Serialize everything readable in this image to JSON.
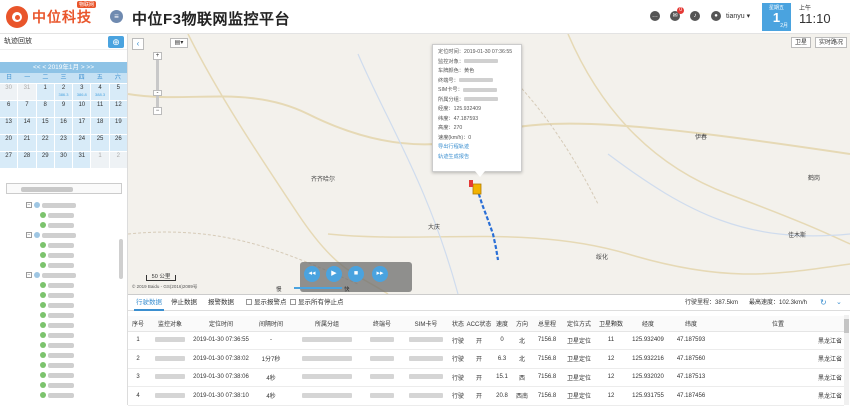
{
  "header": {
    "logo_text": "中位科技",
    "logo_badge": "物联网",
    "title": "中位F3物联网监控平台",
    "notification_count": "0",
    "username": "tianyu",
    "date_week": "星期五",
    "date_day": "1",
    "date_month": "2月",
    "time_ampm": "上午",
    "time": "11:10"
  },
  "left_panel": {
    "title": "轨迹回放",
    "add_icon": "plus-icon",
    "calendar": {
      "nav_label": "<<  < 2019年1月 >  >>",
      "weekdays": [
        "日",
        "一",
        "二",
        "三",
        "四",
        "五",
        "六"
      ],
      "cells": [
        {
          "d": "30",
          "s": "",
          "off": true
        },
        {
          "d": "31",
          "s": "",
          "off": true
        },
        {
          "d": "1",
          "s": "",
          "off": false
        },
        {
          "d": "2",
          "s": "386.3",
          "off": false
        },
        {
          "d": "3",
          "s": "386.8",
          "off": false
        },
        {
          "d": "4",
          "s": "388.3",
          "off": false
        },
        {
          "d": "5",
          "s": "",
          "off": false
        },
        {
          "d": "6",
          "s": "",
          "off": false
        },
        {
          "d": "7",
          "s": "",
          "off": false
        },
        {
          "d": "8",
          "s": "",
          "off": false
        },
        {
          "d": "9",
          "s": "",
          "off": false
        },
        {
          "d": "10",
          "s": "",
          "off": false
        },
        {
          "d": "11",
          "s": "",
          "off": false
        },
        {
          "d": "12",
          "s": "",
          "off": false
        },
        {
          "d": "13",
          "s": "",
          "off": false
        },
        {
          "d": "14",
          "s": "",
          "off": false
        },
        {
          "d": "15",
          "s": "",
          "off": false
        },
        {
          "d": "16",
          "s": "",
          "off": false
        },
        {
          "d": "17",
          "s": "",
          "off": false
        },
        {
          "d": "18",
          "s": "",
          "off": false
        },
        {
          "d": "19",
          "s": "",
          "off": false
        },
        {
          "d": "20",
          "s": "",
          "off": false
        },
        {
          "d": "21",
          "s": "",
          "off": false
        },
        {
          "d": "22",
          "s": "",
          "off": false
        },
        {
          "d": "23",
          "s": "",
          "off": false
        },
        {
          "d": "24",
          "s": "",
          "off": false
        },
        {
          "d": "25",
          "s": "",
          "off": false
        },
        {
          "d": "26",
          "s": "",
          "off": false
        },
        {
          "d": "27",
          "s": "",
          "off": false
        },
        {
          "d": "28",
          "s": "",
          "off": false
        },
        {
          "d": "29",
          "s": "",
          "off": false
        },
        {
          "d": "30",
          "s": "",
          "off": false
        },
        {
          "d": "31",
          "s": "",
          "off": false
        },
        {
          "d": "1",
          "s": "",
          "off": true
        },
        {
          "d": "2",
          "s": "",
          "off": true
        }
      ]
    },
    "query_label": "查询"
  },
  "map": {
    "satellite_label": "卫星",
    "traffic_label": "实时路况",
    "scale_label": "50 公里",
    "copyright": "© 2019 Baidu - GS(2016)2089号",
    "cities": [
      {
        "name": "齐齐哈尔"
      },
      {
        "name": "大庆"
      },
      {
        "name": "伊春"
      },
      {
        "name": "鹤岗"
      },
      {
        "name": "绥化"
      },
      {
        "name": "佳木斯"
      }
    ],
    "popup": {
      "rows": [
        {
          "label": "定位时间：",
          "value": "2019-01-30 07:36:55"
        },
        {
          "label": "监控对象：",
          "value": ""
        },
        {
          "label": "车牌颜色：",
          "value": "黄色"
        },
        {
          "label": "终端号：",
          "value": ""
        },
        {
          "label": "SIM卡号：",
          "value": ""
        },
        {
          "label": "所属分组：",
          "value": ""
        },
        {
          "label": "经度：",
          "value": "125.932409"
        },
        {
          "label": "纬度：",
          "value": "47.187593"
        },
        {
          "label": "高度：",
          "value": "270"
        },
        {
          "label": "速度(km/h)：",
          "value": "0"
        }
      ],
      "link1": "导出行程轨迹",
      "link2": "轨迹生成报告"
    },
    "player": {
      "slow": "慢",
      "fast": "快"
    }
  },
  "bottom": {
    "tabs": [
      "行驶数据",
      "停止数据",
      "报警数据"
    ],
    "check_stop": "显示报警点",
    "check_all_stop": "显示所有停止点",
    "total_mileage": "行驶里程：387.5km",
    "max_speed": "最高速度：102.3km/h",
    "columns": [
      "序号",
      "监控对象",
      "定位时间",
      "间隔时间",
      "所属分组",
      "终端号",
      "SIM卡号",
      "状态",
      "ACC状态",
      "速度",
      "方向",
      "总里程",
      "定位方式",
      "卫星颗数",
      "经度",
      "纬度",
      "位置"
    ],
    "rows": [
      {
        "idx": "1",
        "time": "2019-01-30 07:36:55",
        "interval": "-",
        "status": "行驶",
        "acc": "开",
        "speed": "0",
        "dir": "北",
        "mileage": "7156.8",
        "mode": "卫星定位",
        "sat": "11",
        "lng": "125.932409",
        "lat": "47.187593",
        "pos": "黑龙江省"
      },
      {
        "idx": "2",
        "time": "2019-01-30 07:38:02",
        "interval": "1分7秒",
        "status": "行驶",
        "acc": "开",
        "speed": "6.3",
        "dir": "北",
        "mileage": "7156.8",
        "mode": "卫星定位",
        "sat": "12",
        "lng": "125.932216",
        "lat": "47.187560",
        "pos": "黑龙江省"
      },
      {
        "idx": "3",
        "time": "2019-01-30 07:38:06",
        "interval": "4秒",
        "status": "行驶",
        "acc": "开",
        "speed": "15.1",
        "dir": "西",
        "mileage": "7156.8",
        "mode": "卫星定位",
        "sat": "12",
        "lng": "125.932020",
        "lat": "47.187513",
        "pos": "黑龙江省"
      },
      {
        "idx": "4",
        "time": "2019-01-30 07:38:10",
        "interval": "4秒",
        "status": "行驶",
        "acc": "开",
        "speed": "20.8",
        "dir": "西南",
        "mileage": "7156.8",
        "mode": "卫星定位",
        "sat": "12",
        "lng": "125.931755",
        "lat": "47.187456",
        "pos": "黑龙江省"
      }
    ]
  },
  "colors": {
    "accent": "#4aa3df",
    "brand": "#e9552b",
    "track": "#2a6fd6"
  }
}
